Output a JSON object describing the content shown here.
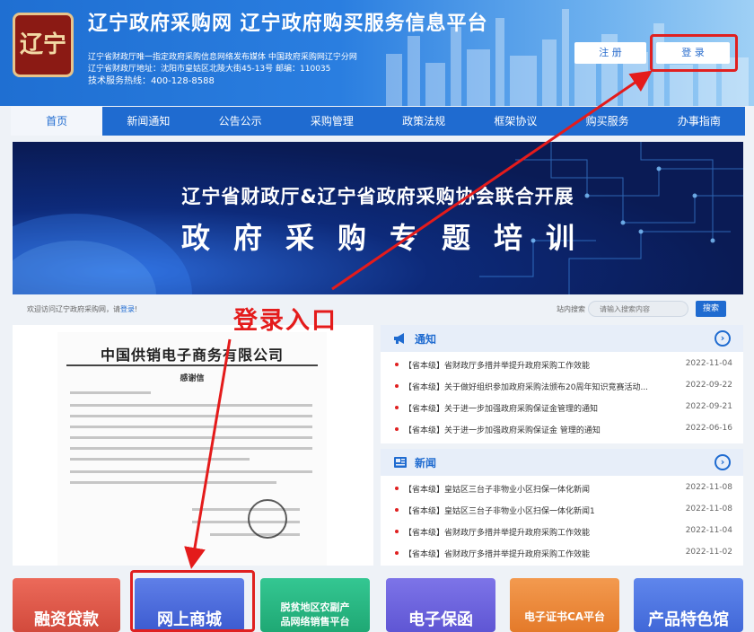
{
  "header": {
    "logo_text": "辽宁",
    "title": "辽宁政府采购网 辽宁政府购买服务信息平台",
    "info_line1": "辽宁省财政厅唯一指定政府采购信息网络发布媒体 中国政府采购网辽宁分网",
    "info_line2": "辽宁省财政厅地址：沈阳市皇姑区北陵大街45-13号 邮编：110035",
    "hotline": "技术服务热线：400-128-8588",
    "register_label": "注 册",
    "login_label": "登 录"
  },
  "nav": {
    "items": [
      {
        "label": "首页"
      },
      {
        "label": "新闻通知"
      },
      {
        "label": "公告公示"
      },
      {
        "label": "采购管理"
      },
      {
        "label": "政策法规"
      },
      {
        "label": "框架协议"
      },
      {
        "label": "购买服务"
      },
      {
        "label": "办事指南"
      }
    ]
  },
  "banner": {
    "line1": "辽宁省财政厅&辽宁省政府采购协会联合开展",
    "line2": "政府采购专题培训"
  },
  "welcome": {
    "text": "欢迎访问辽宁政府采购网，请",
    "link": "登录",
    "suffix": "!"
  },
  "search": {
    "label": "站内搜索",
    "placeholder": "请输入搜索内容",
    "button": "搜索"
  },
  "document": {
    "company": "中国供销电子商务有限公司",
    "subtitle": "感谢信"
  },
  "notice": {
    "title": "通知",
    "more": "›",
    "items": [
      {
        "title": "【省本级】省财政厅多措并举提升政府采购工作效能",
        "date": "2022-11-04"
      },
      {
        "title": "【省本级】关于做好组织参加政府采购法颁布20周年知识竞赛活动...",
        "date": "2022-09-22"
      },
      {
        "title": "【省本级】关于进一步加强政府采购保证金管理的通知",
        "date": "2022-09-21"
      },
      {
        "title": "【省本级】关于进一步加强政府采购保证金 管理的通知",
        "date": "2022-06-16"
      }
    ]
  },
  "news": {
    "title": "新闻",
    "more": "›",
    "items": [
      {
        "title": "【省本级】皇姑区三台子非物业小区扫保一体化新闻",
        "date": "2022-11-08"
      },
      {
        "title": "【省本级】皇姑区三台子非物业小区扫保一体化新闻1",
        "date": "2022-11-08"
      },
      {
        "title": "【省本级】省财政厅多措并举提升政府采购工作效能",
        "date": "2022-11-04"
      },
      {
        "title": "【省本级】省财政厅多措并举提升政府采购工作效能",
        "date": "2022-11-02"
      }
    ]
  },
  "tiles": [
    {
      "label": "融资贷款"
    },
    {
      "label": "网上商城"
    },
    {
      "label_line1": "脱贫地区农副产",
      "label_line2": "品网络销售平台"
    },
    {
      "label": "电子保函"
    },
    {
      "label": "电子证书CA平台"
    },
    {
      "label": "产品特色馆"
    }
  ],
  "annotation": {
    "callout": "登录入口",
    "color": "#e41b1b"
  },
  "colors": {
    "primary": "#1f6bd0",
    "header_bg": "#2a7ee0",
    "date": "#666666"
  }
}
